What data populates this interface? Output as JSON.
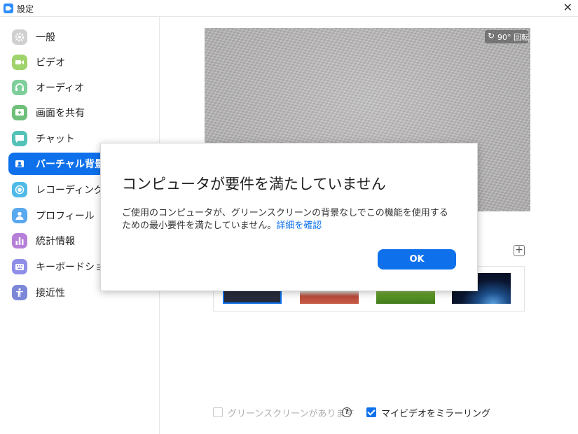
{
  "window": {
    "title": "設定",
    "close_glyph": "✕"
  },
  "sidebar": {
    "items": [
      {
        "label": "一般",
        "icon": "gear-icon",
        "color": "#c8c8c8",
        "active": false
      },
      {
        "label": "ビデオ",
        "icon": "video-camera-icon",
        "color": "#9fd36b",
        "active": false
      },
      {
        "label": "オーディオ",
        "icon": "headphones-icon",
        "color": "#7fcf9b",
        "active": false
      },
      {
        "label": "画面を共有",
        "icon": "share-screen-icon",
        "color": "#6ec07a",
        "active": false
      },
      {
        "label": "チャット",
        "icon": "chat-bubble-icon",
        "color": "#55c2b8",
        "active": false
      },
      {
        "label": "バーチャル背景",
        "icon": "virtual-background-icon",
        "color": "#0e71eb",
        "active": true
      },
      {
        "label": "レコーディングして",
        "icon": "record-icon",
        "color": "#4fb9e8",
        "active": false
      },
      {
        "label": "プロフィール",
        "icon": "profile-icon",
        "color": "#5aa8f0",
        "active": false
      },
      {
        "label": "統計情報",
        "icon": "statistics-icon",
        "color": "#b67fd8",
        "active": false
      },
      {
        "label": "キーボードショー",
        "icon": "keyboard-icon",
        "color": "#8f8ee6",
        "active": false
      },
      {
        "label": "接近性",
        "icon": "accessibility-icon",
        "color": "#7d87d8",
        "active": false
      }
    ]
  },
  "preview": {
    "rotate_label": "90° 回転",
    "rotate_icon": "rotate-icon"
  },
  "background_panel": {
    "add_icon": "plus-icon",
    "thumbnails": [
      "none-selected",
      "bridge",
      "grass",
      "space"
    ]
  },
  "options": {
    "green_screen_label": "グリーンスクリーンがあります",
    "green_screen_checked": false,
    "help_glyph": "?",
    "mirror_label": "マイビデオをミラーリング",
    "mirror_checked": true
  },
  "dialog": {
    "title": "コンピュータが要件を満たしていません",
    "body": "ご使用のコンピュータが、グリーンスクリーンの背景なしでこの機能を使用するための最小要件を満たしていません。",
    "link": "詳細を確認",
    "ok_label": "OK"
  },
  "colors": {
    "accent": "#0e71eb",
    "disabled_text": "#b0b0b0"
  }
}
